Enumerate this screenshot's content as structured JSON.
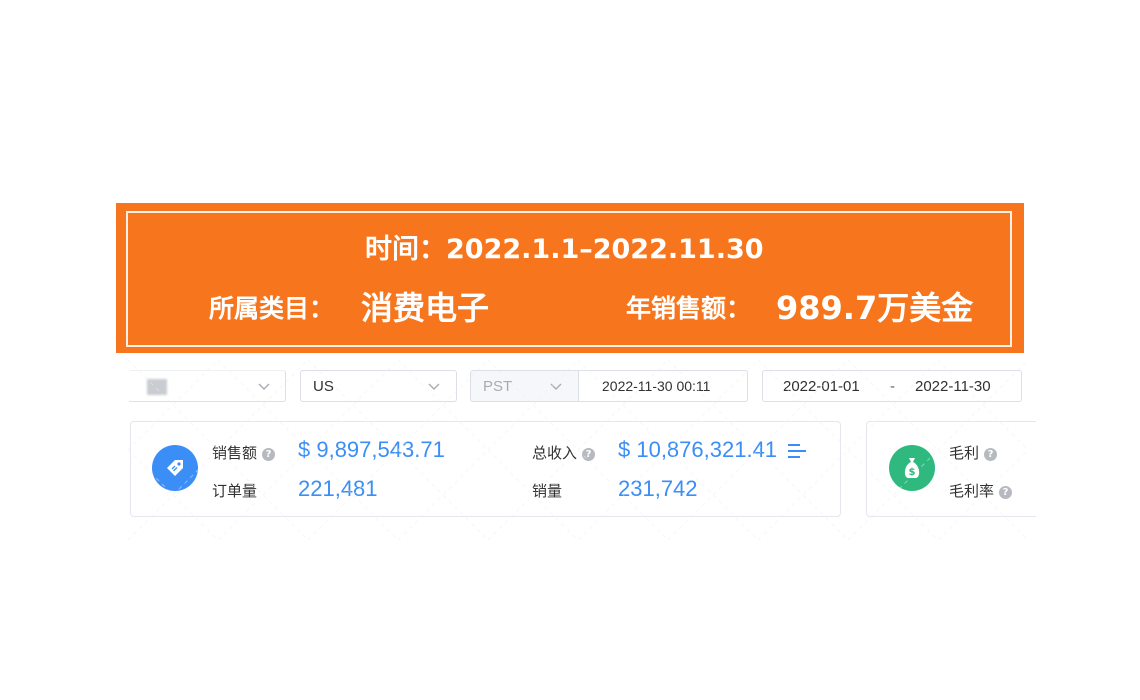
{
  "banner": {
    "time": "时间：2022.1.1–2022.11.30",
    "category_label": "所属类目：",
    "category_value": "消费电子",
    "sales_label": "年销售额：",
    "sales_value": "989.7万美金"
  },
  "filters": {
    "country": "US",
    "timezone": "PST",
    "datetime": "2022-11-30 00:11",
    "date_start": "2022-01-01",
    "date_separator": "-",
    "date_end": "2022-11-30"
  },
  "stats": {
    "sales_amount": {
      "label": "销售额",
      "value": "$ 9,897,543.71"
    },
    "order_count": {
      "label": "订单量",
      "value": "221,481"
    },
    "total_income": {
      "label": "总收入",
      "value": "$ 10,876,321.41"
    },
    "sales_volume": {
      "label": "销量",
      "value": "231,742"
    },
    "gross_profit": {
      "label": "毛利"
    },
    "gross_margin": {
      "label": "毛利率"
    }
  },
  "colors": {
    "banner": "#f7761d",
    "accent_blue": "#3a8ef6",
    "accent_green": "#2fb97f"
  },
  "icons": {
    "sales": "price-tag-icon",
    "profit": "money-bag-icon",
    "help": "question-icon",
    "detail": "list-icon"
  }
}
